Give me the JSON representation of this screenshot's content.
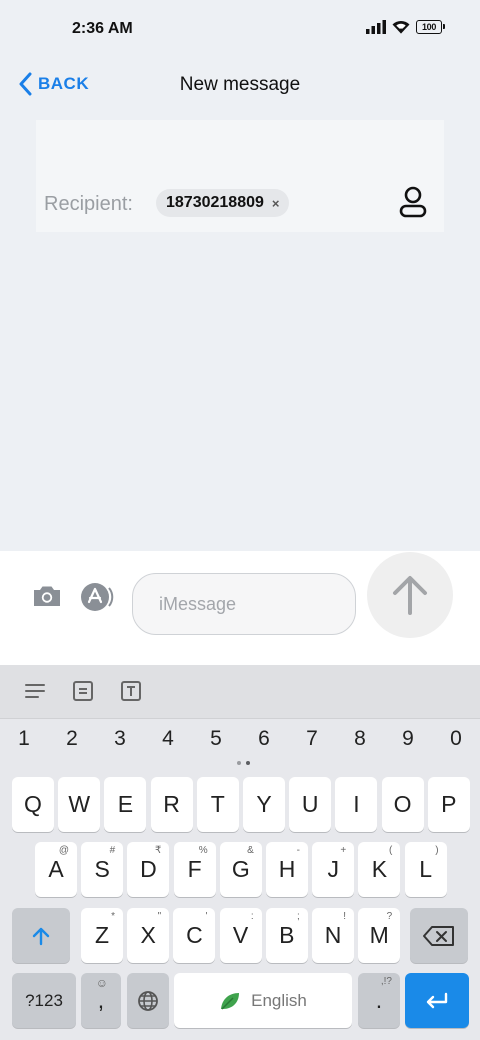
{
  "status": {
    "time": "2:36 AM",
    "battery": "100"
  },
  "nav": {
    "back_label": "BACK",
    "title": "New message"
  },
  "recipient": {
    "label": "Recipient:",
    "chip": "18730218809",
    "chip_remove": "×"
  },
  "compose": {
    "placeholder": "iMessage"
  },
  "keyboard": {
    "numbers": [
      "1",
      "2",
      "3",
      "4",
      "5",
      "6",
      "7",
      "8",
      "9",
      "0"
    ],
    "row1": [
      "Q",
      "W",
      "E",
      "R",
      "T",
      "Y",
      "U",
      "I",
      "O",
      "P"
    ],
    "row2": [
      {
        "key": "A",
        "hint": "@"
      },
      {
        "key": "S",
        "hint": "#"
      },
      {
        "key": "D",
        "hint": "₹"
      },
      {
        "key": "F",
        "hint": "%"
      },
      {
        "key": "G",
        "hint": "&"
      },
      {
        "key": "H",
        "hint": "-"
      },
      {
        "key": "J",
        "hint": "+"
      },
      {
        "key": "K",
        "hint": "("
      },
      {
        "key": "L",
        "hint": ")"
      }
    ],
    "row3": [
      {
        "key": "Z",
        "hint": "*"
      },
      {
        "key": "X",
        "hint": "\""
      },
      {
        "key": "C",
        "hint": "'"
      },
      {
        "key": "V",
        "hint": ":"
      },
      {
        "key": "B",
        "hint": ";"
      },
      {
        "key": "N",
        "hint": "!"
      },
      {
        "key": "M",
        "hint": "?"
      }
    ],
    "symbols_label": "?123",
    "comma": ",",
    "space_label": "English",
    "period": ".",
    "period_hint": ",!?"
  },
  "colors": {
    "accent": "#1a7fe8",
    "enter_key": "#1a8ae8",
    "background": "#edf0f4"
  }
}
